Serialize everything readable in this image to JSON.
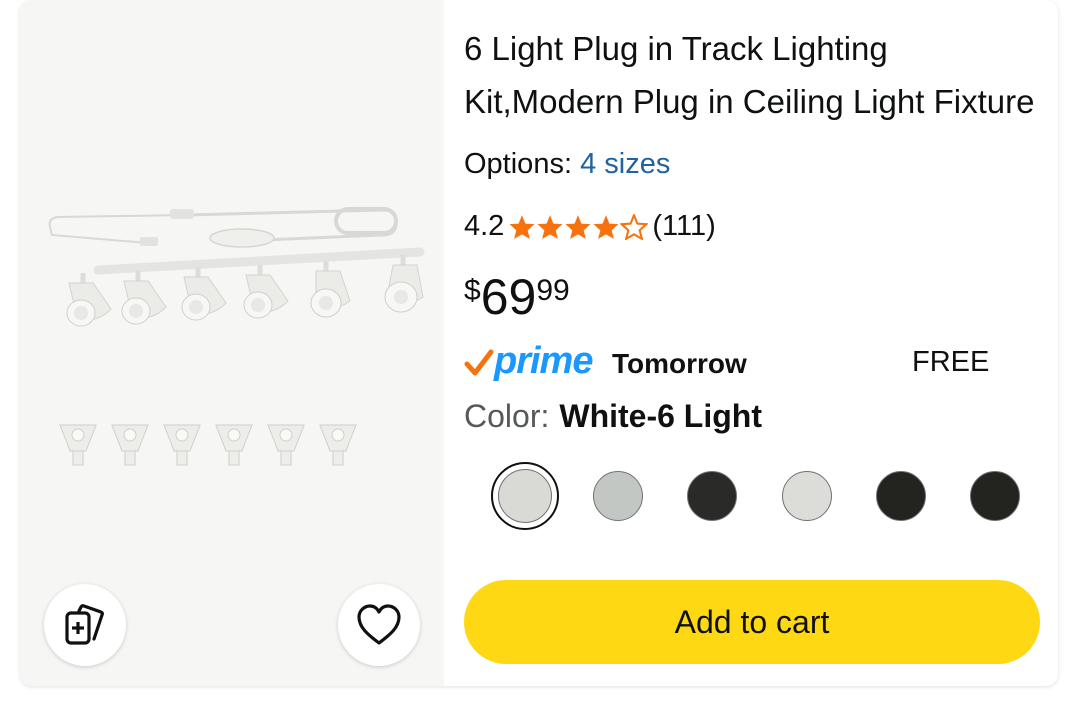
{
  "product": {
    "title": "6 Light Plug in Track Lighting Kit,Modern Plug in Ceiling Light Fixture",
    "options_label": "Options:",
    "options_value": "4 sizes",
    "rating": "4.2",
    "stars_filled": 4.2,
    "rating_count": "(111)",
    "price_symbol": "$",
    "price_whole": "69",
    "price_fraction": "99",
    "prime_label": "prime",
    "delivery": "Tomorrow",
    "shipping": "FREE",
    "color_label": "Color:",
    "color_value": "White-6 Light",
    "add_to_cart": "Add to cart"
  },
  "swatches": [
    {
      "color": "#d9d9d6",
      "selected": true
    },
    {
      "color": "#c2c7c4",
      "selected": false
    },
    {
      "color": "#2a2a28",
      "selected": false
    },
    {
      "color": "#dcdcd8",
      "selected": false
    },
    {
      "color": "#23231f",
      "selected": false
    },
    {
      "color": "#23231f",
      "selected": false
    }
  ],
  "colors": {
    "star": "#f7710d",
    "link": "#2162a1",
    "cart_button": "#ffd814",
    "prime_blue": "#1a98ff",
    "prime_check": "#f7710d"
  },
  "icons": {
    "compare": "compare-cards-icon",
    "wishlist": "heart-icon"
  }
}
